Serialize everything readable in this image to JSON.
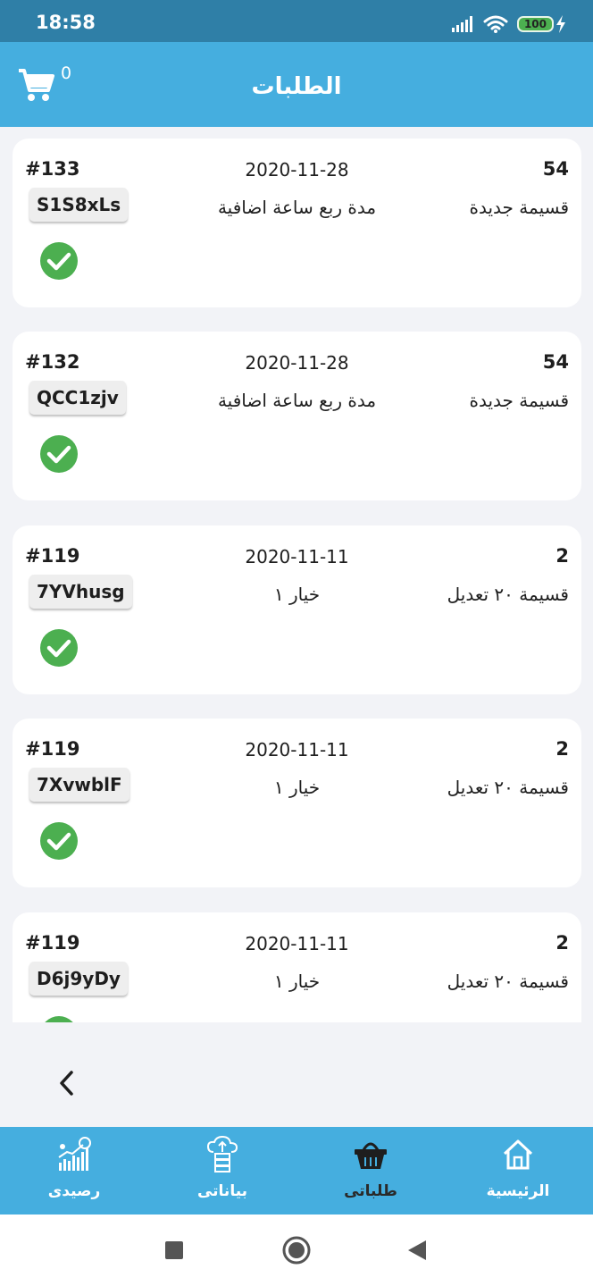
{
  "status_bar": {
    "time": "18:58",
    "battery": "100"
  },
  "app_bar": {
    "title": "الطلبات",
    "cart_count": "0"
  },
  "orders": [
    {
      "id": "#133",
      "date": "2020-11-28",
      "count": "54",
      "type": "قسيمة جديدة",
      "detail": "مدة ربع ساعة اضافية",
      "code": "S1S8xLs",
      "status": "check-circle-icon"
    },
    {
      "id": "#132",
      "date": "2020-11-28",
      "count": "54",
      "type": "قسيمة جديدة",
      "detail": "مدة ربع ساعة اضافية",
      "code": "QCC1zjv",
      "status": "check-circle-icon"
    },
    {
      "id": "#119",
      "date": "2020-11-11",
      "count": "2",
      "type": "قسيمة ٢٠ تعديل",
      "detail": "خيار ١",
      "code": "7YVhusg",
      "status": "check-circle-icon"
    },
    {
      "id": "#119",
      "date": "2020-11-11",
      "count": "2",
      "type": "قسيمة ٢٠ تعديل",
      "detail": "خيار ١",
      "code": "7XvwblF",
      "status": "check-circle-icon"
    },
    {
      "id": "#119",
      "date": "2020-11-11",
      "count": "2",
      "type": "قسيمة ٢٠ تعديل",
      "detail": "خيار ١",
      "code": "D6j9yDy",
      "status": "check-circle-icon"
    }
  ],
  "bottom_nav": {
    "items": [
      {
        "label": "الرئيسية",
        "icon": "home-icon"
      },
      {
        "label": "طلباتى",
        "icon": "basket-icon",
        "active": true
      },
      {
        "label": "بياناتى",
        "icon": "cloud-server-icon"
      },
      {
        "label": "رصيدى",
        "icon": "balance-chart-icon"
      }
    ]
  },
  "colors": {
    "primary": "#45aedf",
    "status_bar": "#2f7fa7",
    "check": "#4caf50",
    "background": "#f2f3f7"
  }
}
